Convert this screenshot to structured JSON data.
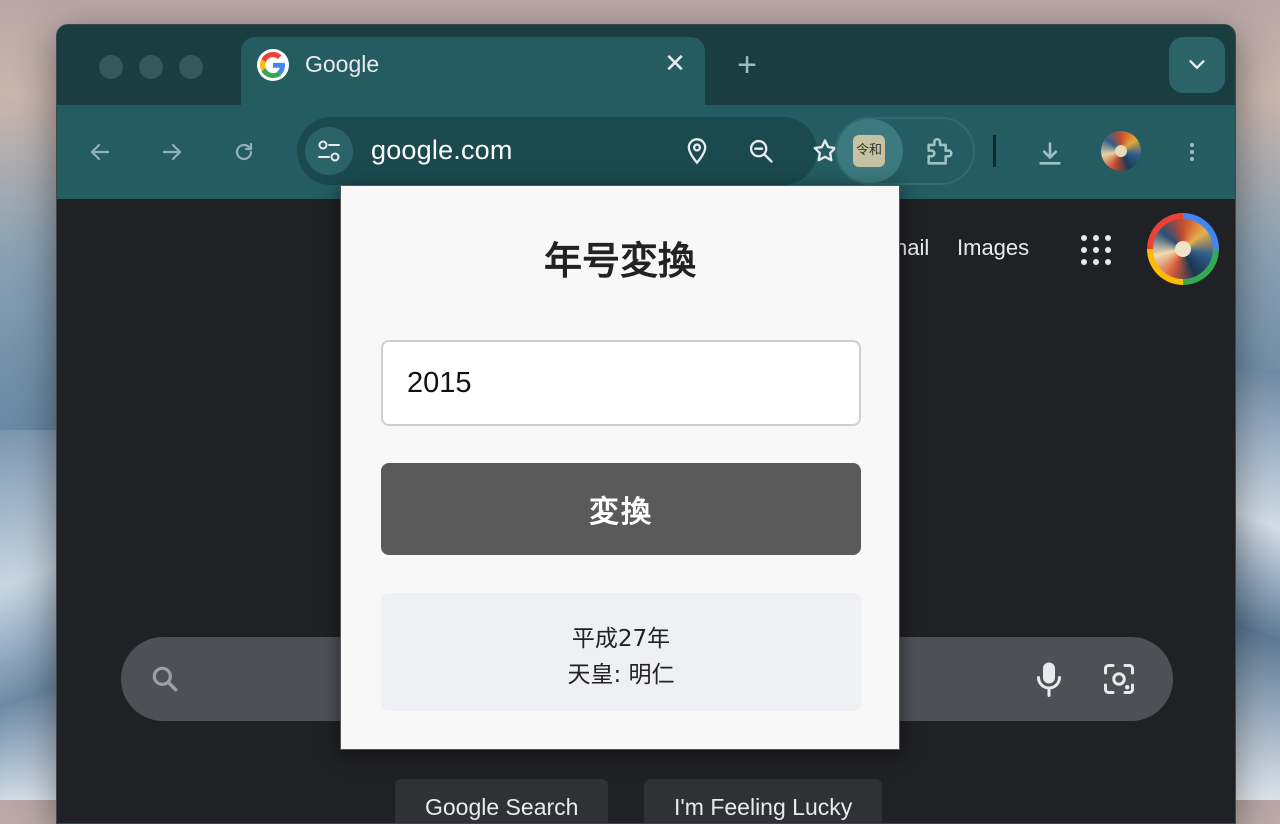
{
  "browser": {
    "tab": {
      "title": "Google",
      "close_symbol": "✕"
    },
    "new_tab_symbol": "+",
    "omnibox": {
      "url": "google.com"
    },
    "extension_badge": "令和"
  },
  "google_page": {
    "nav": {
      "gmail_partial": "nail",
      "images": "Images"
    },
    "buttons": {
      "search": "Google Search",
      "lucky": "I'm Feeling Lucky"
    }
  },
  "popup": {
    "title": "年号変換",
    "input_value": "2015",
    "convert_label": "変換",
    "result": {
      "era_line": "平成27年",
      "emperor_line": "天皇: 明仁"
    }
  },
  "colors": {
    "tabstrip": "#193d41",
    "toolbar": "#245c61",
    "page_bg": "#202124",
    "popup_bg": "#f8f8f8",
    "convert_button": "#5a5a5a",
    "result_bg": "#eef0f3"
  },
  "icons": [
    "back-arrow-icon",
    "forward-arrow-icon",
    "reload-icon",
    "site-info-icon",
    "location-icon",
    "zoom-out-icon",
    "star-icon",
    "extensions-puzzle-icon",
    "download-icon",
    "more-vert-icon",
    "apps-grid-icon",
    "search-icon",
    "mic-icon",
    "lens-icon",
    "chevron-down-icon",
    "google-g-icon"
  ]
}
